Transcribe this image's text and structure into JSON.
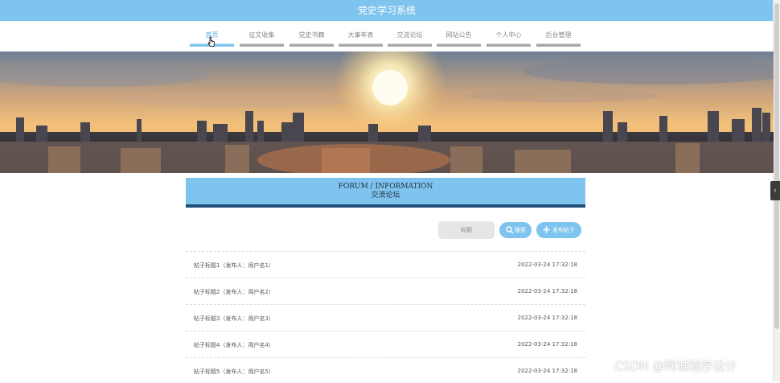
{
  "app": {
    "title": "党史学习系统"
  },
  "nav": {
    "items": [
      {
        "label": "首页",
        "active": true
      },
      {
        "label": "征文收集"
      },
      {
        "label": "党史书籍"
      },
      {
        "label": "大事年表"
      },
      {
        "label": "交流论坛"
      },
      {
        "label": "网站公告"
      },
      {
        "label": "个人中心"
      },
      {
        "label": "后台管理"
      }
    ]
  },
  "section": {
    "title_en": "FORUM / INFORMATION",
    "title_cn": "交流论坛"
  },
  "search": {
    "placeholder": "标题",
    "search_label": "搜索",
    "add_label": "发布帖子",
    "search_icon": "search-icon",
    "add_icon": "plus-icon"
  },
  "posts": [
    {
      "title": "帖子标题1（发布人：用户名1）",
      "time": "2022-03-24 17:32:18"
    },
    {
      "title": "帖子标题2（发布人：用户名2）",
      "time": "2022-03-24 17:32:18"
    },
    {
      "title": "帖子标题3（发布人：用户名3）",
      "time": "2022-03-24 17:32:18"
    },
    {
      "title": "帖子标题4（发布人：用户名4）",
      "time": "2022-03-24 17:32:18"
    },
    {
      "title": "帖子标题5（发布人：用户名5）",
      "time": "2022-03-24 17:32:18"
    }
  ],
  "watermark": "CSDN @阿城程序设计",
  "colors": {
    "accent": "#7fc4ee",
    "dark_accent": "#1e4f7a"
  }
}
